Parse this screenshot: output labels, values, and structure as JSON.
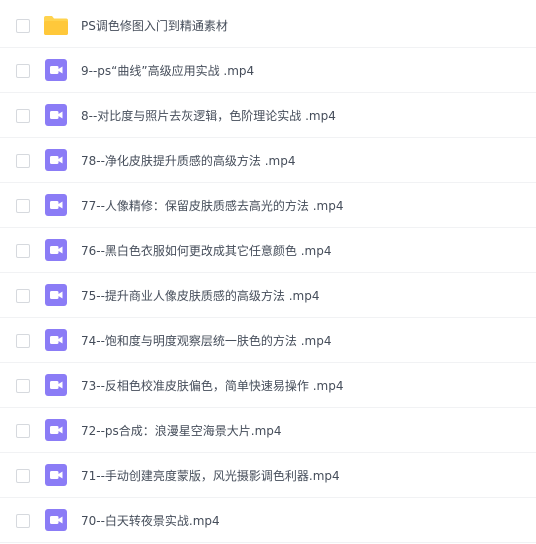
{
  "files": [
    {
      "name": "PS调色修图入门到精通素材",
      "type": "folder",
      "icon": "folder-icon"
    },
    {
      "name": "9--ps“曲线”高级应用实战 .mp4",
      "type": "video",
      "icon": "video-file-icon"
    },
    {
      "name": "8--对比度与照片去灰逻辑，色阶理论实战 .mp4",
      "type": "video",
      "icon": "video-file-icon"
    },
    {
      "name": "78--净化皮肤提升质感的高级方法 .mp4",
      "type": "video",
      "icon": "video-file-icon"
    },
    {
      "name": "77--人像精修：保留皮肤质感去高光的方法 .mp4",
      "type": "video",
      "icon": "video-file-icon"
    },
    {
      "name": "76--黑白色衣服如何更改成其它任意颜色 .mp4",
      "type": "video",
      "icon": "video-file-icon"
    },
    {
      "name": "75--提升商业人像皮肤质感的高级方法 .mp4",
      "type": "video",
      "icon": "video-file-icon"
    },
    {
      "name": "74--饱和度与明度观察层统一肤色的方法 .mp4",
      "type": "video",
      "icon": "video-file-icon"
    },
    {
      "name": "73--反相色校准皮肤偏色，简单快速易操作 .mp4",
      "type": "video",
      "icon": "video-file-icon"
    },
    {
      "name": "72--ps合成：浪漫星空海景大片.mp4",
      "type": "video",
      "icon": "video-file-icon"
    },
    {
      "name": "71--手动创建亮度蒙版，风光摄影调色利器.mp4",
      "type": "video",
      "icon": "video-file-icon"
    },
    {
      "name": "70--白天转夜景实战.mp4",
      "type": "video",
      "icon": "video-file-icon"
    }
  ],
  "colors": {
    "folder": "#ffd34e",
    "video": "#8b7cf6",
    "text": "#454d5a"
  }
}
